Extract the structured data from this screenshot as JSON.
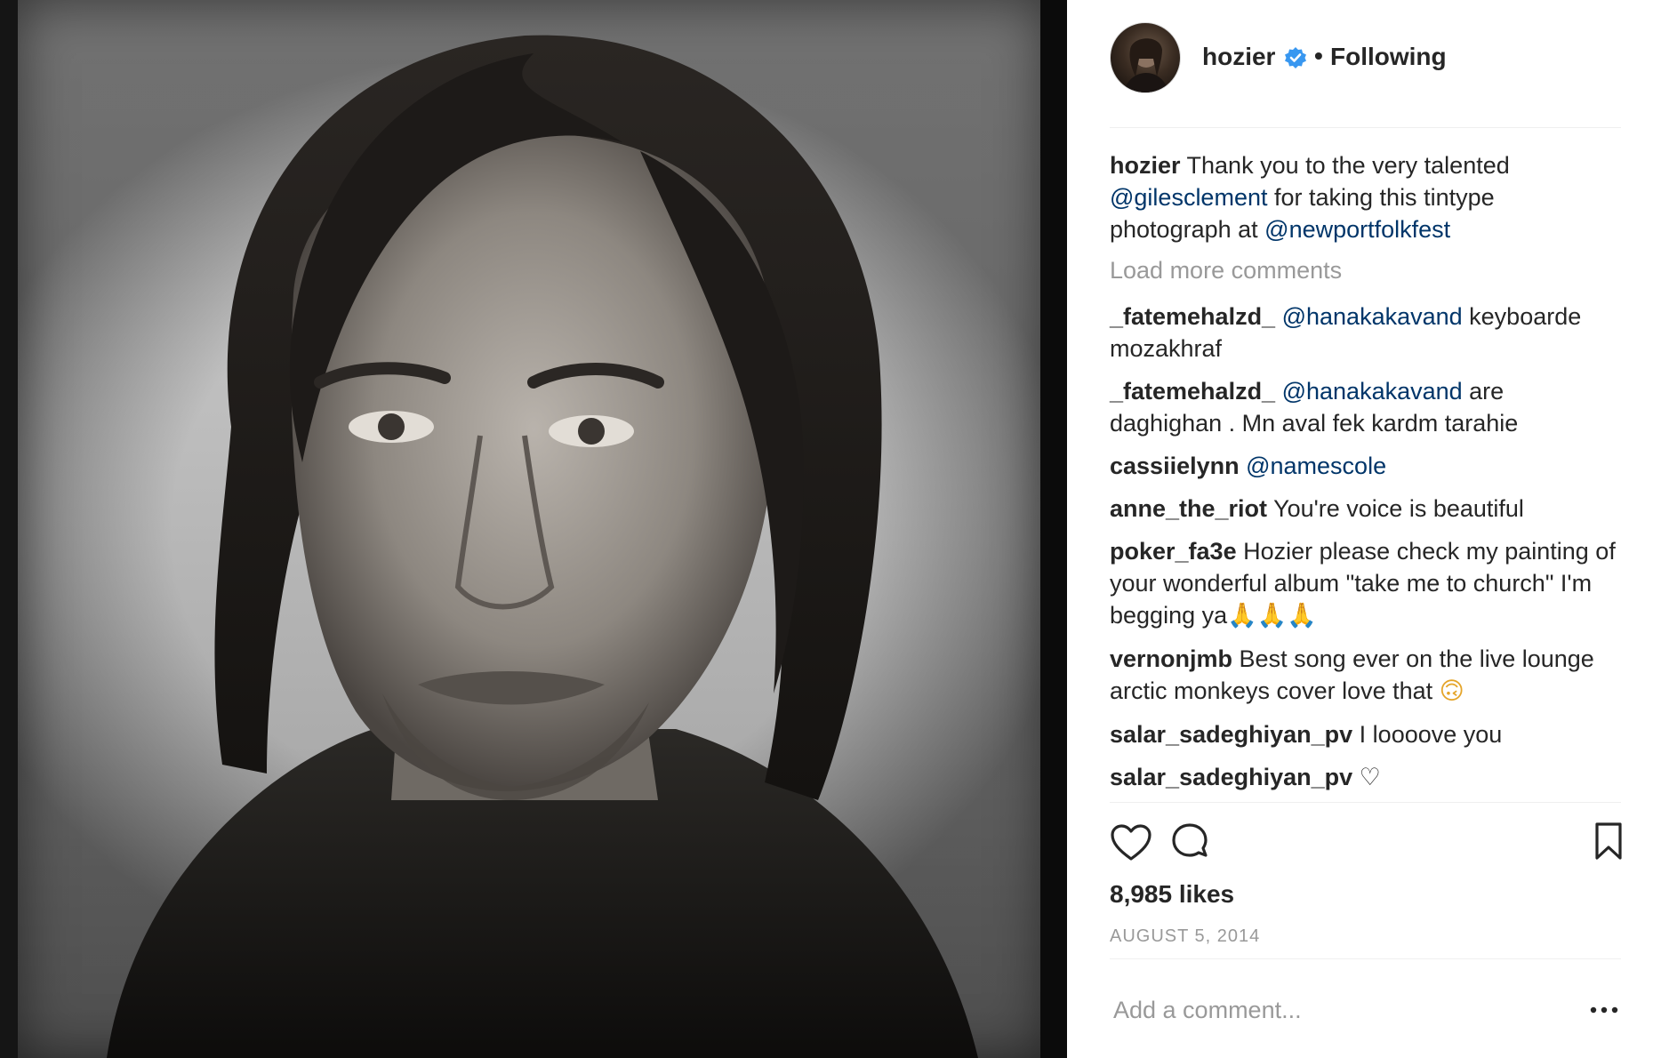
{
  "post": {
    "username": "hozier",
    "separator": "•",
    "follow_status": "Following",
    "avatar_icon": "avatar",
    "verified_icon": "verified-badge-icon",
    "verified_color": "#3897f0"
  },
  "caption": {
    "username": "hozier",
    "text_1": " Thank you to the very talented ",
    "mention_1": "@gilesclement",
    "text_2": " for taking this tintype photograph at ",
    "mention_2": "@newportfolkfest"
  },
  "load_more": "Load more comments",
  "comments": [
    {
      "user": "_fatemehalzd_",
      "mention": "@hanakakavand",
      "text": " keyboarde mozakhraf",
      "emoji": ""
    },
    {
      "user": "_fatemehalzd_",
      "mention": "@hanakakavand",
      "text": " are daghighan . Mn aval fek kardm tarahie",
      "emoji": ""
    },
    {
      "user": "cassiielynn",
      "mention": "@namescole",
      "text": "",
      "emoji": ""
    },
    {
      "user": "anne_the_riot",
      "mention": "",
      "text": "You're voice is beautiful",
      "emoji": ""
    },
    {
      "user": "poker_fa3e",
      "mention": "",
      "text": "Hozier please check my painting of your wonderful album \"take me to church\" I'm begging ya",
      "emoji": "🙏🙏🙏"
    },
    {
      "user": "vernonjmb",
      "mention": "",
      "text": "Best song ever on the live lounge arctic monkeys cover love that ",
      "emoji": "🙃"
    },
    {
      "user": "salar_sadeghiyan_pv",
      "mention": "",
      "text": "I loooove you",
      "emoji": ""
    },
    {
      "user": "salar_sadeghiyan_pv",
      "mention": "",
      "text": "",
      "emoji": "♡"
    }
  ],
  "actions": {
    "like_icon": "heart-icon",
    "comment_icon": "comment-icon",
    "save_icon": "bookmark-icon"
  },
  "likes": "8,985 likes",
  "date": "AUGUST 5, 2014",
  "add_comment_placeholder": "Add a comment...",
  "more_icon": "more-options-icon",
  "colors": {
    "text": "#262626",
    "mention": "#003569",
    "muted": "#999999",
    "divider": "#efefef"
  }
}
